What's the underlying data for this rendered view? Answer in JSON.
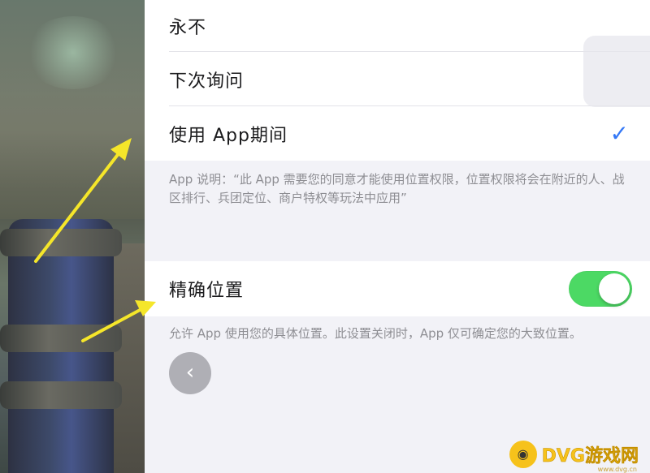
{
  "location_options": {
    "never": "永不",
    "ask_next_time": "下次询问",
    "while_using": "使用 App期间",
    "selected_mark": "✓"
  },
  "usage_note": "App 说明：“此 App 需要您的同意才能使用位置权限，位置权限将会在附近的人、战区排行、兵团定位、商户特权等玩法中应用”",
  "precise_location": {
    "label": "精确位置",
    "enabled": true,
    "description": "允许 App 使用您的具体位置。此设置关闭时，App 仅可确定您的大致位置。"
  },
  "back_button": {
    "icon": "chevron-left-icon",
    "glyph": "‹"
  },
  "watermark": {
    "logo_glyph": "◉",
    "text": "DVG游戏网",
    "sub": "www.dvg.cn"
  },
  "colors": {
    "accent": "#3478f6",
    "toggle_on": "#4cd964",
    "arrow": "#f5e62a",
    "watermark": "#f6c21b"
  }
}
